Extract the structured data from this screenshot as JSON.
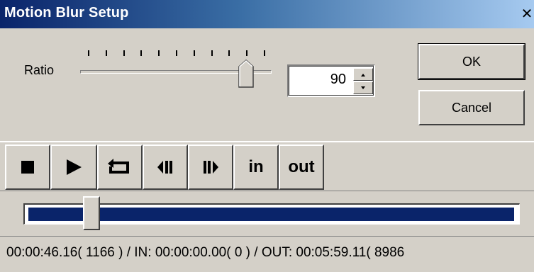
{
  "window": {
    "title": "Motion Blur Setup",
    "close_glyph": "✕"
  },
  "ratio": {
    "label": "Ratio",
    "value": "90",
    "slider_fraction": 0.9
  },
  "buttons": {
    "ok": "OK",
    "cancel": "Cancel"
  },
  "toolbar": {
    "stop_icon": "stop-icon",
    "play_icon": "play-icon",
    "loop_icon": "loop-icon",
    "prev_icon": "step-back-icon",
    "next_icon": "step-forward-icon",
    "in_label": "in",
    "out_label": "out"
  },
  "timeline": {
    "position_fraction": 0.13
  },
  "status": {
    "text": "00:00:46.16( 1166 ) / IN: 00:00:00.00( 0 ) / OUT: 00:05:59.11( 8986"
  },
  "colors": {
    "titlebar": "#0a246a",
    "timeline_fill": "#0a246a",
    "face": "#d4d0c8"
  }
}
